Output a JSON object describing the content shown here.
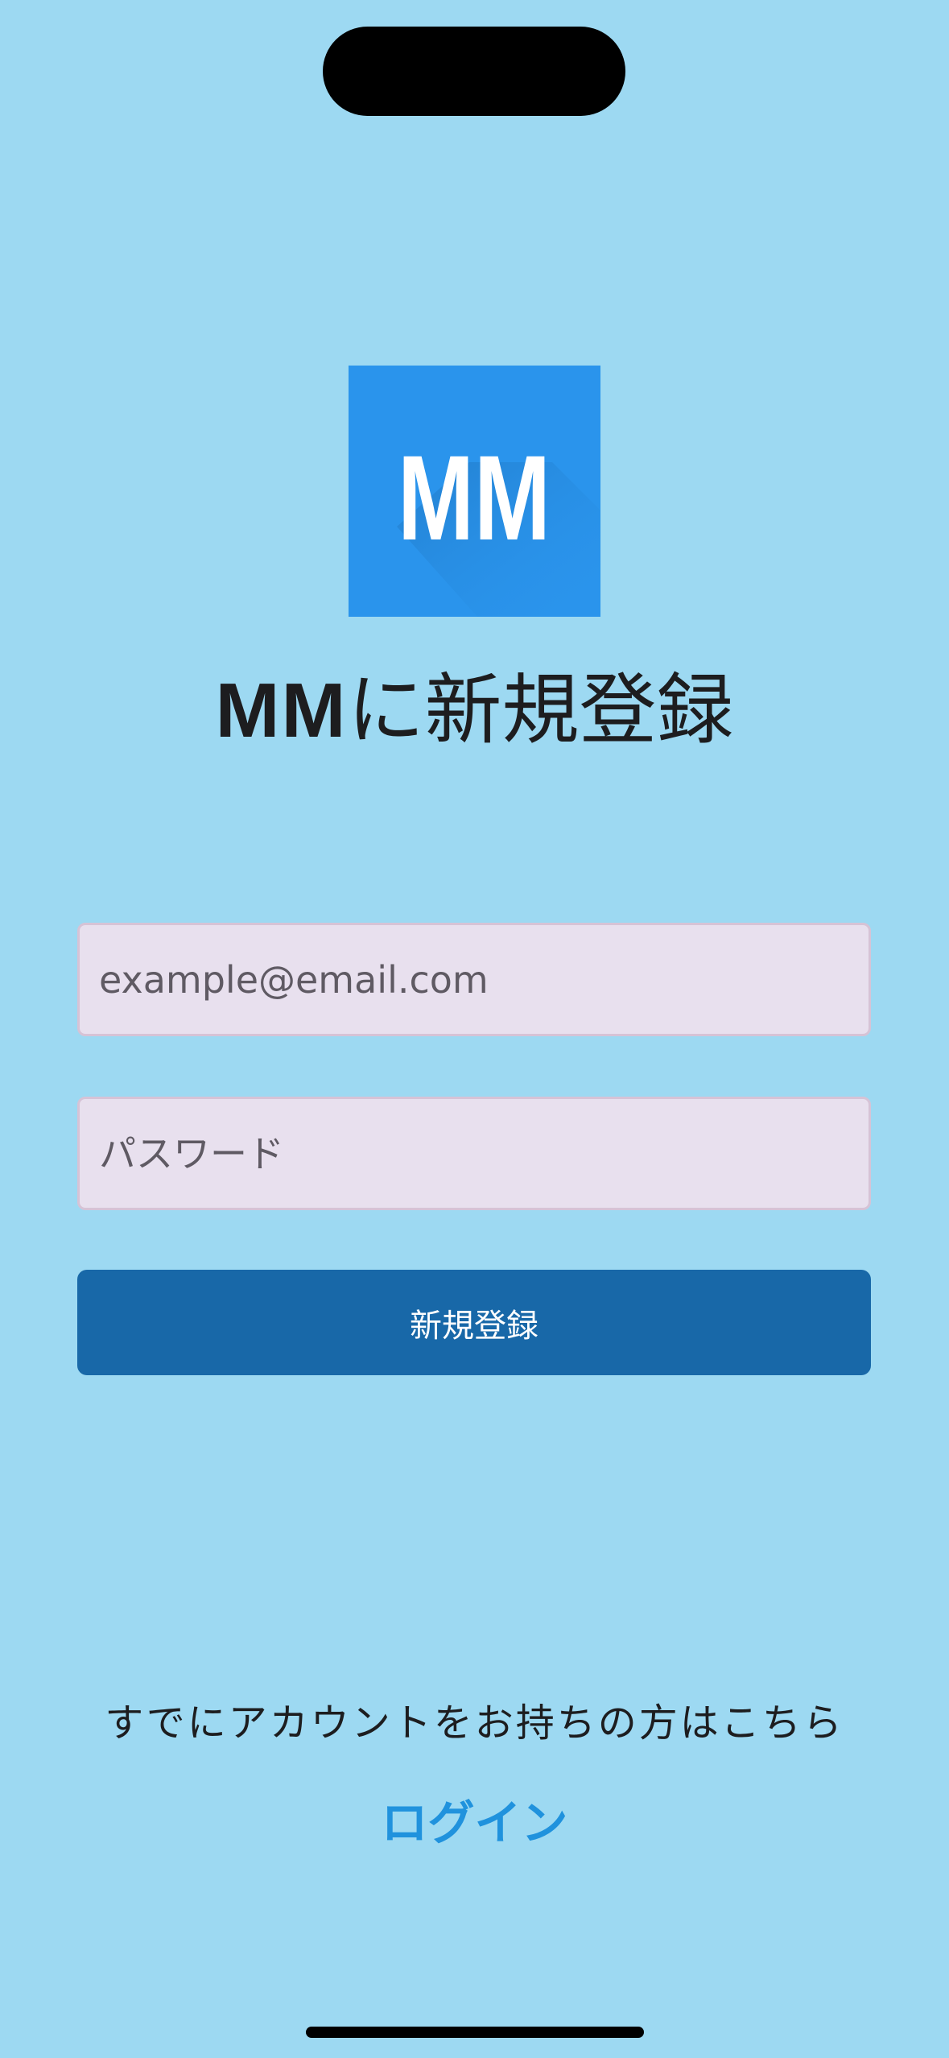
{
  "logo": {
    "text": "MM",
    "bg_color": "#2a94ec"
  },
  "header": {
    "title_brand": "MM",
    "title_rest": "に新規登録"
  },
  "form": {
    "email_placeholder": "example@email.com",
    "password_placeholder": "パスワード",
    "submit_label": "新規登録"
  },
  "footer": {
    "prompt": "すでにアカウントをお持ちの方はこちら",
    "login_label": "ログイン"
  },
  "colors": {
    "background": "#9dd9f2",
    "button": "#1868a8",
    "link": "#2092dd",
    "field_bg": "#e8e0ee"
  }
}
